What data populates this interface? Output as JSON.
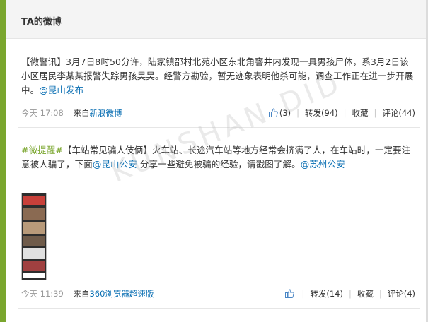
{
  "panel": {
    "title": "TA的微博"
  },
  "posts": [
    {
      "text": {
        "p1": "【微警讯】3月7日8时50分许，陆家镇邵村北苑小区东北角窨井内发现一具男孩尸体，系3月2日该小区居民李某某报警失踪男孩昊昊。经警方勘验，暂无迹象表明他杀可能，调查工作正在进一步开展中。",
        "mention": "@昆山发布"
      },
      "time": "今天 17:08",
      "source_prefix": "来自",
      "source_link": "新浪微博",
      "actions": {
        "like_count": "(3)",
        "forward": "转发(94)",
        "favorite": "收藏",
        "comment": "评论(44)"
      }
    },
    {
      "text": {
        "topic": "#微提醒#",
        "p1": "【车站常见骗人伎俩】火车站、长途汽车站等地方经常会挤满了人，在车站时，一定要注意被人骗了，下面",
        "mention1": "@昆山公安",
        "p2": " 分享一些避免被骗的经验，请戳图了解。",
        "mention2": "@苏州公安"
      },
      "time": "今天 11:39",
      "source_prefix": "来自",
      "source_link": "360浏览器超速版",
      "actions": {
        "forward": "转发(14)",
        "favorite": "收藏",
        "comment": "评论(4)"
      }
    }
  ],
  "watermark": "KUNSHAN DID",
  "colors": {
    "accent_green": "#7aa62e",
    "link_blue": "#0a6fb3"
  },
  "icons": [
    "thumb-up-icon"
  ]
}
